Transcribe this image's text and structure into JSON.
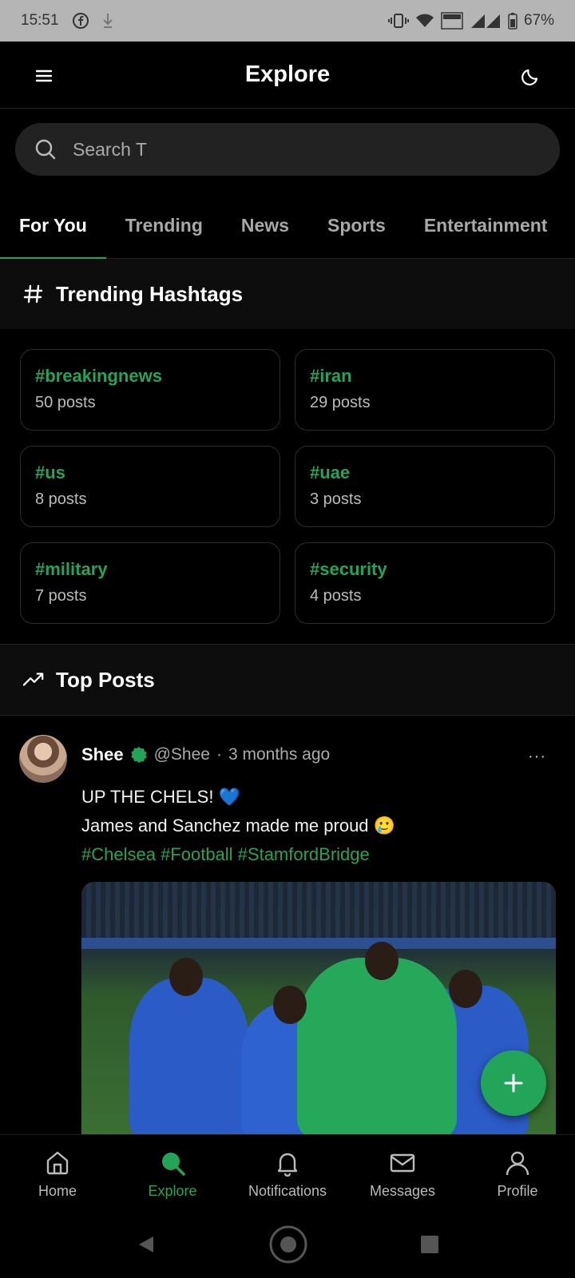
{
  "status_bar": {
    "time": "15:51",
    "battery": "67%",
    "icons": [
      "facebook-icon",
      "download-icon",
      "vibrate-icon",
      "wifi-icon",
      "volte-icon",
      "signal-icon",
      "battery-icon"
    ]
  },
  "header": {
    "title": "Explore",
    "menu_icon": "menu-icon",
    "theme_icon": "moon-icon"
  },
  "search": {
    "value": "",
    "placeholder": "Search T"
  },
  "tabs": [
    {
      "label": "For You",
      "active": true
    },
    {
      "label": "Trending",
      "active": false
    },
    {
      "label": "News",
      "active": false
    },
    {
      "label": "Sports",
      "active": false
    },
    {
      "label": "Entertainment",
      "active": false
    }
  ],
  "trending": {
    "title": "Trending Hashtags",
    "icon": "#",
    "hashtags": [
      {
        "tag": "#breakingnews",
        "count": "50 posts"
      },
      {
        "tag": "#iran",
        "count": "29 posts"
      },
      {
        "tag": "#us",
        "count": "8 posts"
      },
      {
        "tag": "#uae",
        "count": "3 posts"
      },
      {
        "tag": "#military",
        "count": "7 posts"
      },
      {
        "tag": "#security",
        "count": "4 posts"
      }
    ]
  },
  "top_posts": {
    "title": "Top Posts"
  },
  "post": {
    "name": "Shee",
    "handle": "@Shee",
    "separator": "·",
    "time": "3 months ago",
    "more": "···",
    "line1": "UP THE CHELS! 💙",
    "line2": "James and Sanchez made me proud 🥲",
    "tags": "#Chelsea #Football #StamfordBridge"
  },
  "bottom_nav": [
    {
      "label": "Home",
      "icon": "home-icon",
      "active": false
    },
    {
      "label": "Explore",
      "icon": "search-icon",
      "active": true
    },
    {
      "label": "Notifications",
      "icon": "bell-icon",
      "active": false
    },
    {
      "label": "Messages",
      "icon": "mail-icon",
      "active": false
    },
    {
      "label": "Profile",
      "icon": "user-icon",
      "active": false
    }
  ],
  "colors": {
    "accent": "#22a559",
    "background": "#000000",
    "card_border": "#2c2c2c"
  }
}
